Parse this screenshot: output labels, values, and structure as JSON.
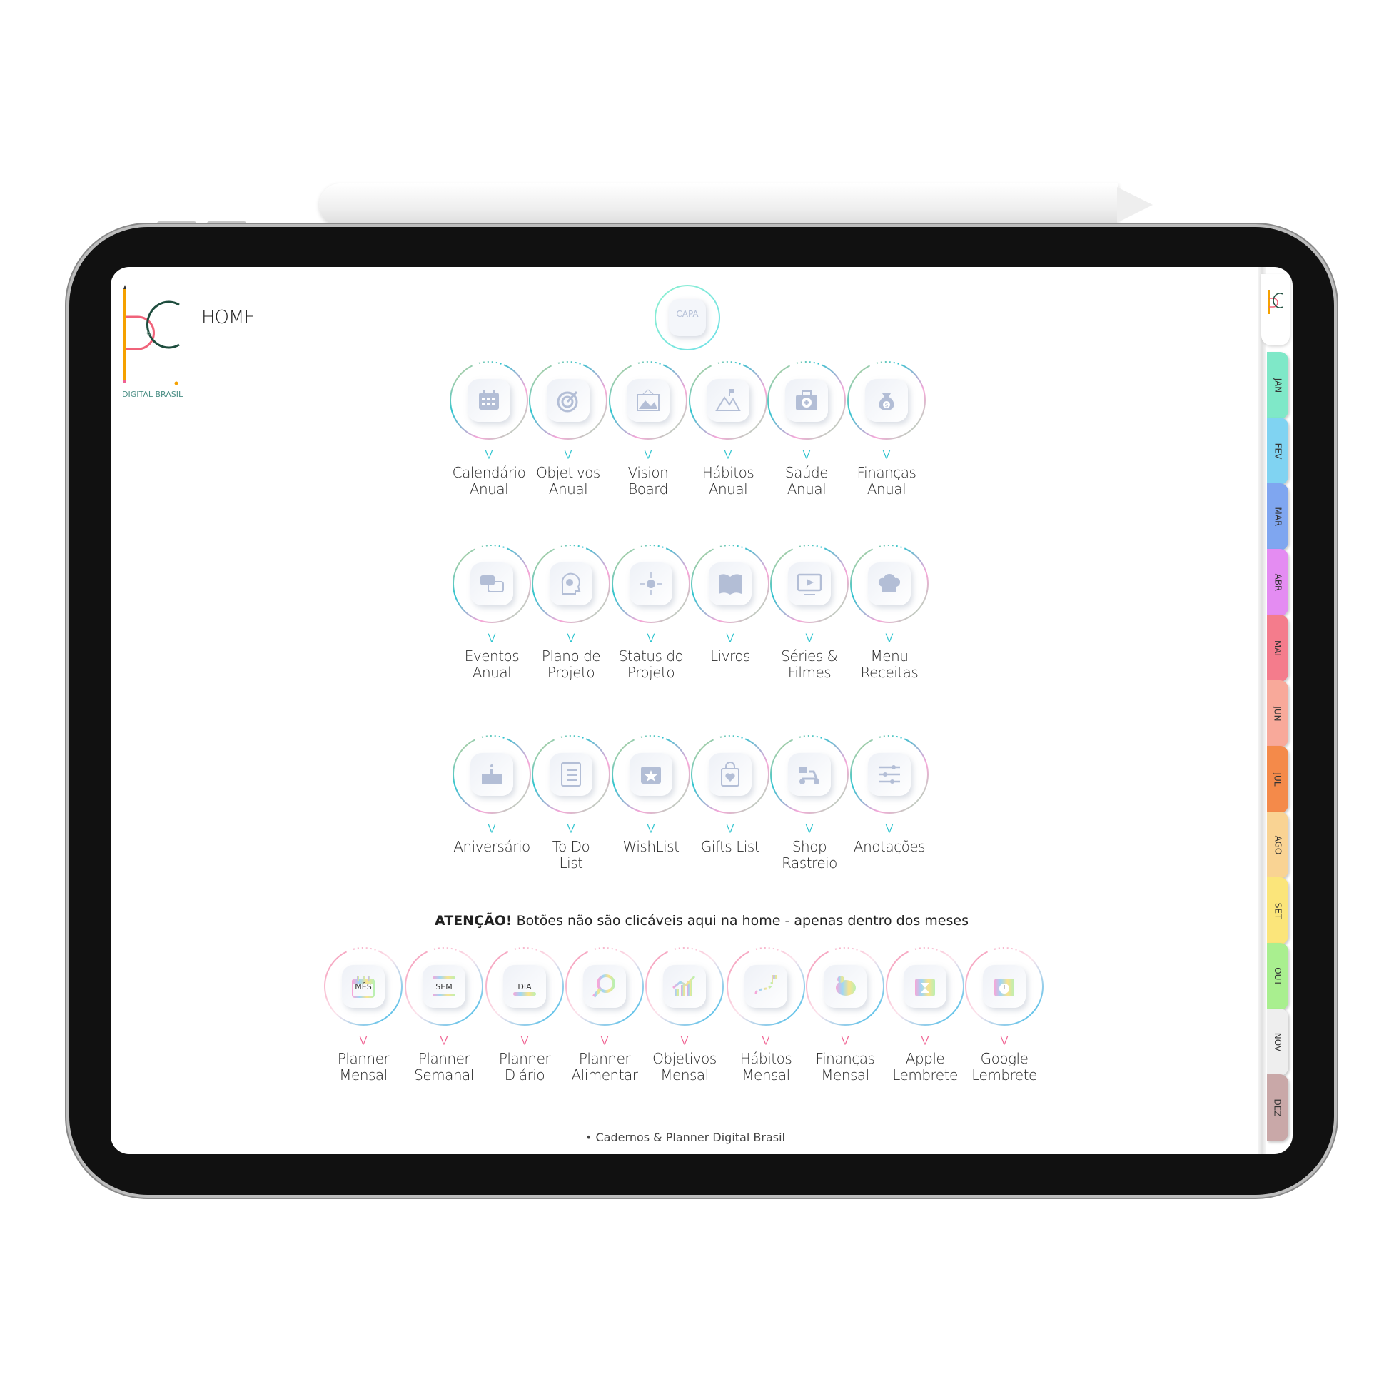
{
  "header": {
    "title": "HOME",
    "logo_text": "DIGITAL BRASIL"
  },
  "capa": {
    "label": "CAPA"
  },
  "rows": [
    [
      {
        "lines": [
          "Calendário",
          "Anual"
        ],
        "icon": "calendar-icon"
      },
      {
        "lines": [
          "Objetivos",
          "Anual"
        ],
        "icon": "target-icon"
      },
      {
        "lines": [
          "Vision",
          "Board"
        ],
        "icon": "picture-frame-icon"
      },
      {
        "lines": [
          "Hábitos",
          "Anual"
        ],
        "icon": "mountain-flag-icon"
      },
      {
        "lines": [
          "Saúde",
          "Anual"
        ],
        "icon": "first-aid-kit-icon"
      },
      {
        "lines": [
          "Finanças",
          "Anual"
        ],
        "icon": "money-bag-icon"
      }
    ],
    [
      {
        "lines": [
          "Eventos",
          "Anual"
        ],
        "icon": "chat-bubbles-icon"
      },
      {
        "lines": [
          "Plano de",
          "Projeto"
        ],
        "icon": "head-gears-icon"
      },
      {
        "lines": [
          "Status do",
          "Projeto"
        ],
        "icon": "lightbulb-network-icon"
      },
      {
        "lines": [
          "Livros"
        ],
        "icon": "book-icon"
      },
      {
        "lines": [
          "Séries &",
          "Filmes"
        ],
        "icon": "tv-play-icon"
      },
      {
        "lines": [
          "Menu",
          "Receitas"
        ],
        "icon": "chef-hat-icon"
      }
    ],
    [
      {
        "lines": [
          "Aniversário"
        ],
        "icon": "birthday-cake-icon"
      },
      {
        "lines": [
          "To Do",
          "List"
        ],
        "icon": "checklist-icon"
      },
      {
        "lines": [
          "WishList"
        ],
        "icon": "calendar-star-icon"
      },
      {
        "lines": [
          "Gifts List"
        ],
        "icon": "shopping-bag-heart-icon"
      },
      {
        "lines": [
          "Shop",
          "Rastreio"
        ],
        "icon": "delivery-scooter-icon"
      },
      {
        "lines": [
          "Anotações"
        ],
        "icon": "sliders-icon"
      }
    ]
  ],
  "attention": {
    "bold": "ATENÇÃO!",
    "text": " Botões não são clicáveis aqui na home - apenas dentro dos meses"
  },
  "monthly": [
    {
      "lines": [
        "Planner",
        "Mensal"
      ],
      "icon": "calendar-month-icon",
      "badge": "MÊS"
    },
    {
      "lines": [
        "Planner",
        "Semanal"
      ],
      "icon": "week-slider-icon",
      "badge": "SEM"
    },
    {
      "lines": [
        "Planner",
        "Diário"
      ],
      "icon": "day-slider-icon",
      "badge": "DIA"
    },
    {
      "lines": [
        "Planner",
        "Alimentar"
      ],
      "icon": "magnifier-icon"
    },
    {
      "lines": [
        "Objetivos",
        "Mensal"
      ],
      "icon": "growth-chart-icon"
    },
    {
      "lines": [
        "Hábitos",
        "Mensal"
      ],
      "icon": "path-flag-icon"
    },
    {
      "lines": [
        "Finanças",
        "Mensal"
      ],
      "icon": "piggy-bank-icon"
    },
    {
      "lines": [
        "Apple",
        "Lembrete"
      ],
      "icon": "calendar-hourglass-icon"
    },
    {
      "lines": [
        "Google",
        "Lembrete"
      ],
      "icon": "calendar-alarm-icon"
    }
  ],
  "footer": "• Cadernos & Planner Digital Brasil",
  "tabs": [
    {
      "label": "JAN",
      "color": "#7fe8c8"
    },
    {
      "label": "FEV",
      "color": "#80d3f2"
    },
    {
      "label": "MAR",
      "color": "#7fa6f0"
    },
    {
      "label": "ABR",
      "color": "#e48cf2"
    },
    {
      "label": "MAI",
      "color": "#f47c8c"
    },
    {
      "label": "JUN",
      "color": "#f8a99a"
    },
    {
      "label": "JUL",
      "color": "#f48a4a"
    },
    {
      "label": "AGO",
      "color": "#f9d393"
    },
    {
      "label": "SET",
      "color": "#fbe57a"
    },
    {
      "label": "OUT",
      "color": "#a9ef8f"
    },
    {
      "label": "NOV",
      "color": "#eeeeee"
    },
    {
      "label": "DEZ",
      "color": "#c9a8a8"
    }
  ],
  "colors": {
    "icon_gray": "#b3bed6",
    "ring_teal": "#2ec4cf",
    "ring_pink": "#f48fb1",
    "ring_blue": "#29b6e8"
  }
}
